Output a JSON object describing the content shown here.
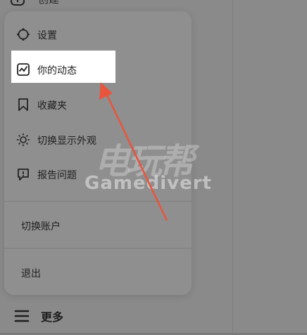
{
  "top_item": {
    "label": "创建",
    "icon": "create-icon"
  },
  "menu": {
    "items": [
      {
        "label": "设置",
        "icon": "gear-icon"
      },
      {
        "label": "你的动态",
        "icon": "activity-icon"
      },
      {
        "label": "收藏夹",
        "icon": "bookmark-icon"
      },
      {
        "label": "切换显示外观",
        "icon": "sun-icon"
      },
      {
        "label": "报告问题",
        "icon": "report-icon"
      }
    ],
    "switch_account": "切换账户",
    "logout": "退出"
  },
  "more": {
    "label": "更多",
    "icon": "menu-icon"
  },
  "watermark": {
    "cn": "电玩帮",
    "en": "Gamedivert"
  },
  "colors": {
    "arrow": "#e8553e",
    "highlight": "#ffffff",
    "overlay": "#8a8a8a"
  }
}
